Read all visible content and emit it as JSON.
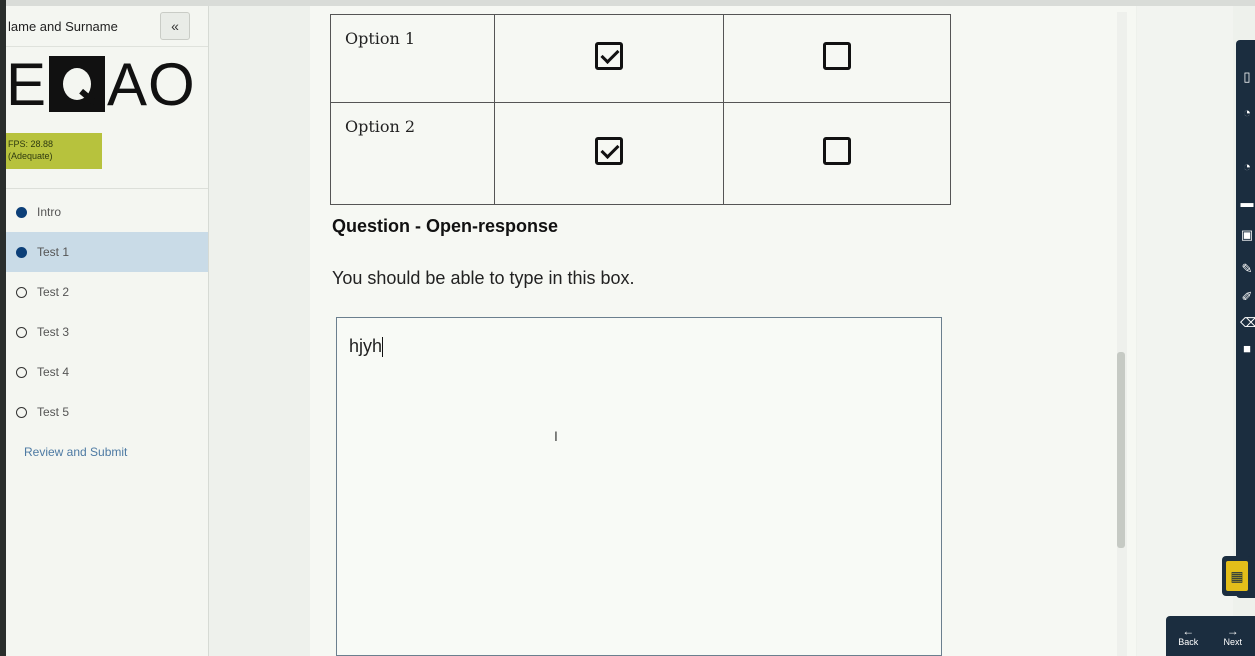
{
  "sidebar": {
    "user_name": "lame and Surname",
    "collapse_label": "«",
    "logo_left": "E",
    "logo_right": "AO",
    "fps_line1": "FPS: 28.88",
    "fps_line2": "(Adequate)",
    "items": [
      {
        "label": "Intro",
        "state": "filled"
      },
      {
        "label": "Test 1",
        "state": "filled",
        "active": true
      },
      {
        "label": "Test 2",
        "state": "empty"
      },
      {
        "label": "Test 3",
        "state": "empty"
      },
      {
        "label": "Test 4",
        "state": "empty"
      },
      {
        "label": "Test 5",
        "state": "empty"
      }
    ],
    "review_label": "Review and Submit"
  },
  "main": {
    "options": [
      {
        "label": "Option 1",
        "col1_checked": true,
        "col2_checked": false
      },
      {
        "label": "Option 2",
        "col1_checked": true,
        "col2_checked": false
      }
    ],
    "question_title": "Question - Open-response",
    "question_prompt": "You should be able to type in this box.",
    "answer_value": "hjyh",
    "cursor_glyph": "I"
  },
  "nav": {
    "back_label": "Back",
    "next_label": "Next",
    "back_arrow": "←",
    "next_arrow": "→"
  },
  "colors": {
    "accent_navy": "#1b2d3f",
    "active_dot": "#0c3f78",
    "fps_badge": "#b7c23d",
    "calculator": "#e3be1a"
  }
}
